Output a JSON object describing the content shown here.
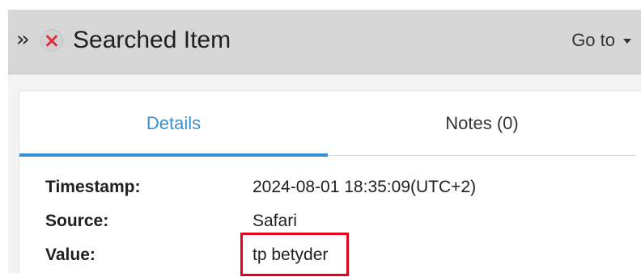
{
  "header": {
    "title": "Searched Item",
    "expand_icon": "double-chevron-right-icon",
    "close_icon": "close-circle-icon",
    "goto_label": "Go to",
    "goto_icon": "caret-down-icon"
  },
  "tabs": [
    {
      "label": "Details",
      "active": true
    },
    {
      "label": "Notes (0)",
      "active": false
    }
  ],
  "details": [
    {
      "label": "Timestamp:",
      "value": "2024-08-01 18:35:09(UTC+2)"
    },
    {
      "label": "Source:",
      "value": "Safari"
    },
    {
      "label": "Value:",
      "value": "tp betyder"
    }
  ],
  "colors": {
    "accent": "#3a8fd0",
    "header_bg": "#d7d7d7",
    "close_x": "#e03040",
    "highlight": "#e5001c"
  }
}
